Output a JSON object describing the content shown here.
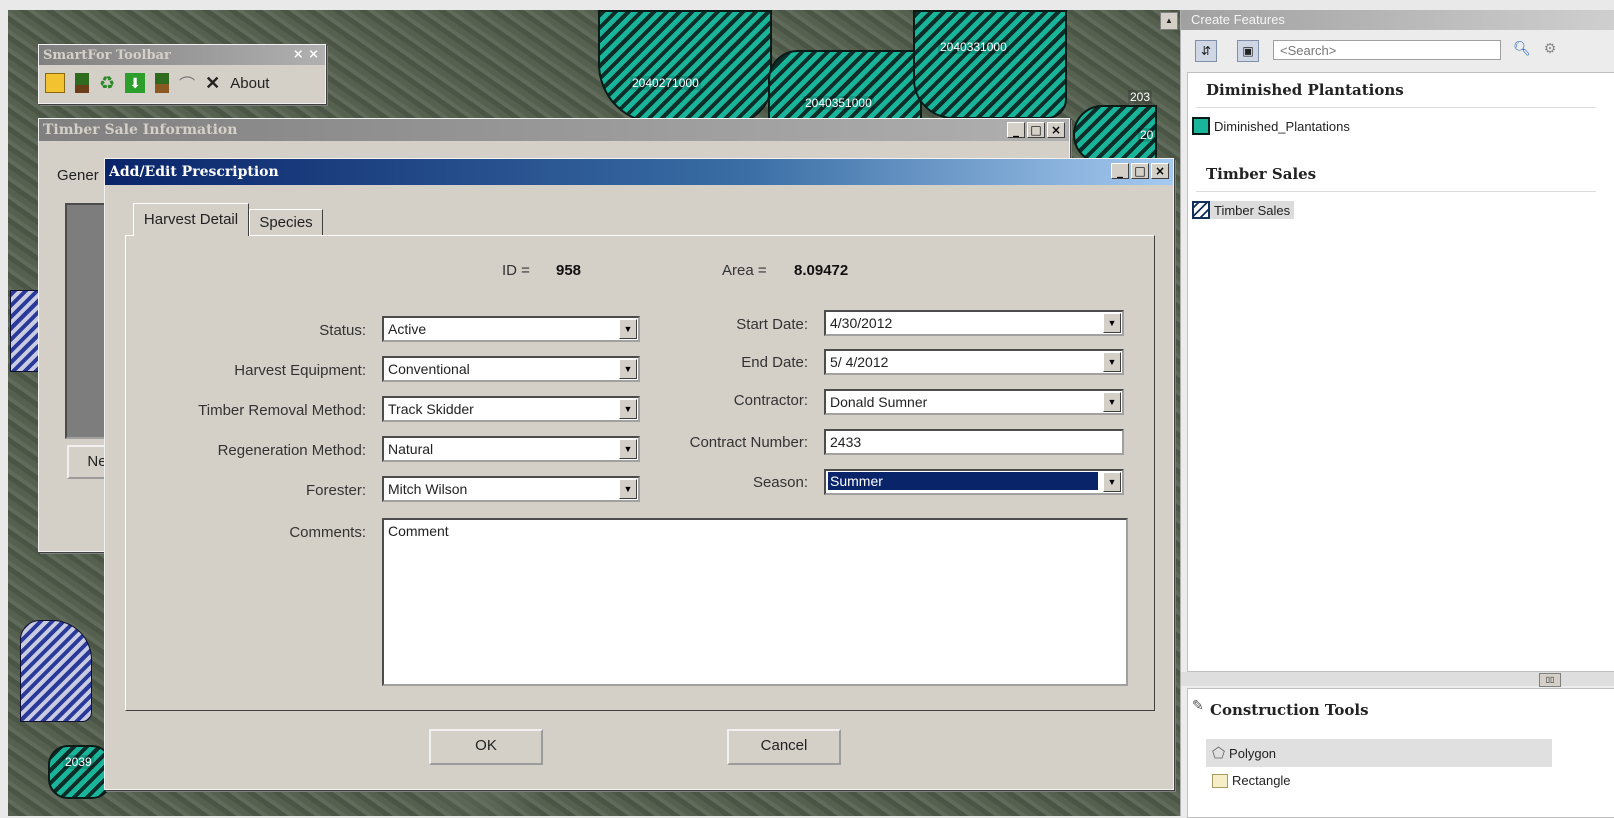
{
  "map": {
    "labels": [
      "2040271000",
      "2040351000",
      "2040331000",
      "203",
      "20",
      "2039"
    ]
  },
  "smartfor_toolbar": {
    "title": "SmartFor Toolbar",
    "close_symbol": "× ×",
    "about_label": "About",
    "icons": [
      "folder-icon",
      "tree-icon",
      "recycle-icon",
      "download-icon",
      "tree-add-icon",
      "arch-icon",
      "delete-icon"
    ]
  },
  "timber_sale_window": {
    "title": "Timber Sale Information",
    "tab_partial": "Gener",
    "new_button_partial": "Ne"
  },
  "dialog": {
    "title": "Add/Edit Prescription",
    "tabs": [
      "Harvest Detail",
      "Species"
    ],
    "id_label": "ID =",
    "id_value": "958",
    "area_label": "Area =",
    "area_value": "8.09472",
    "fields": {
      "status": {
        "label": "Status:",
        "value": "Active"
      },
      "harvest_equipment": {
        "label": "Harvest Equipment:",
        "value": "Conventional"
      },
      "timber_removal": {
        "label": "Timber Removal Method:",
        "value": "Track Skidder"
      },
      "regeneration": {
        "label": "Regeneration Method:",
        "value": "Natural"
      },
      "forester": {
        "label": "Forester:",
        "value": "Mitch Wilson"
      },
      "start_date": {
        "label": "Start Date:",
        "value": "4/30/2012"
      },
      "end_date": {
        "label": "End Date:",
        "value": "5/ 4/2012"
      },
      "contractor": {
        "label": "Contractor:",
        "value": "Donald Sumner"
      },
      "contract_number": {
        "label": "Contract Number:",
        "value": "2433"
      },
      "season": {
        "label": "Season:",
        "value": "Summer"
      },
      "comments": {
        "label": "Comments:",
        "value": "Comment"
      }
    },
    "ok_label": "OK",
    "cancel_label": "Cancel"
  },
  "create_features": {
    "title": "Create Features",
    "search_placeholder": "<Search>",
    "groups": [
      {
        "header": "Diminished Plantations",
        "item": "Diminished_Plantations"
      },
      {
        "header": "Timber Sales",
        "item": "Timber Sales"
      }
    ],
    "construction_tools_title": "Construction Tools",
    "tools": [
      "Polygon",
      "Rectangle"
    ]
  },
  "colors": {
    "title_active": "#0a246a",
    "hatch_green": "#18b59a",
    "selection": "#0a246a"
  }
}
